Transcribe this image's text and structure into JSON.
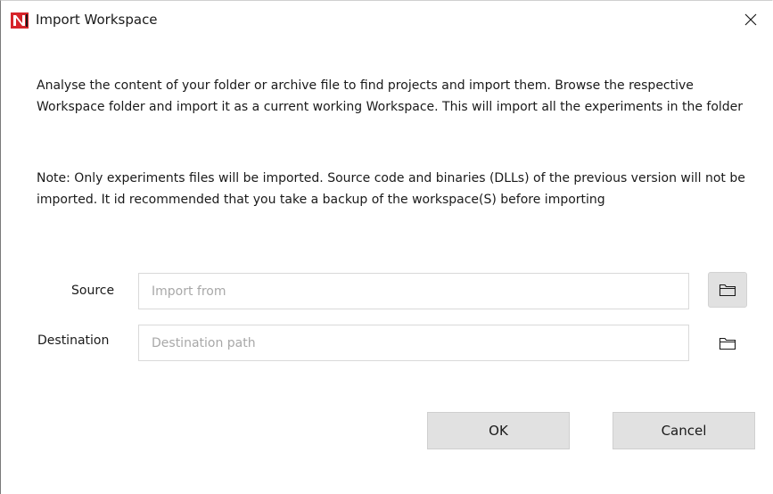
{
  "window": {
    "title": "Import Workspace",
    "logo_icon": "app-logo-icon",
    "close_icon": "close-icon"
  },
  "content": {
    "description": "Analyse the content of your folder or archive file to find projects and import them. Browse the respective Workspace folder and import it as a current working Workspace. This will import all the experiments in the folder",
    "note": "Note: Only experiments files will be imported. Source code and binaries (DLLs) of the previous version will not be imported. It id recommended that you take a backup of the workspace(S) before importing"
  },
  "form": {
    "source": {
      "label": "Source",
      "value": "",
      "placeholder": "Import from",
      "browse_icon": "folder-icon"
    },
    "destination": {
      "label": "Destination",
      "value": "",
      "placeholder": "Destination path",
      "browse_icon": "folder-icon"
    }
  },
  "buttons": {
    "ok_label": "OK",
    "cancel_label": "Cancel"
  },
  "colors": {
    "logo_red": "#d6242a",
    "button_bg": "#e1e1e1",
    "input_border": "#d9d9d9",
    "placeholder": "#a8a8a8"
  }
}
